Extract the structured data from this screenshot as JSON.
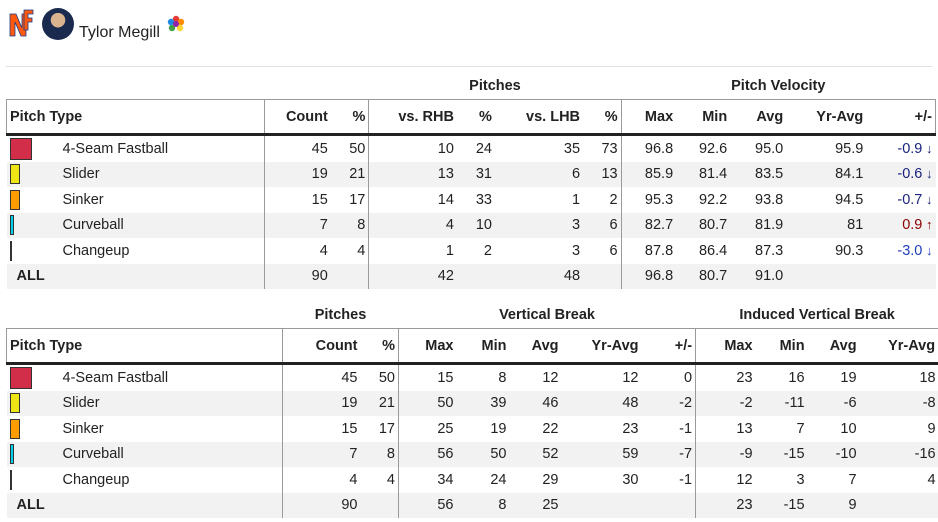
{
  "player": {
    "name": "Tylor Megill",
    "team_logo": "mets-ny-logo",
    "badge_icon": "rainbow-flower-icon"
  },
  "colors": {
    "fastball": "#d22d49",
    "slider": "#efe514",
    "sinker": "#fe9d00",
    "curveball": "#00d1ed",
    "changeup": "#1dbe3a"
  },
  "table1": {
    "group_headers": {
      "pitches": "Pitches",
      "velocity": "Pitch Velocity"
    },
    "columns": [
      "Pitch Type",
      "Count",
      "%",
      "vs. RHB",
      "%",
      "vs. LHB",
      "%",
      "Max",
      "Min",
      "Avg",
      "Yr-Avg",
      "+/-"
    ],
    "rows": [
      {
        "name": "4-Seam Fastball",
        "swatch_color": "#d22d49",
        "count": "45",
        "pct": "50",
        "rhb": "10",
        "rhb_pct": "24",
        "lhb": "35",
        "lhb_pct": "73",
        "max": "96.8",
        "min": "92.6",
        "avg": "95.0",
        "yr_avg": "95.9",
        "diff": "-0.9",
        "dir": "down"
      },
      {
        "name": "Slider",
        "swatch_color": "#efe514",
        "count": "19",
        "pct": "21",
        "rhb": "13",
        "rhb_pct": "31",
        "lhb": "6",
        "lhb_pct": "13",
        "max": "85.9",
        "min": "81.4",
        "avg": "83.5",
        "yr_avg": "84.1",
        "diff": "-0.6",
        "dir": "down"
      },
      {
        "name": "Sinker",
        "swatch_color": "#fe9d00",
        "count": "15",
        "pct": "17",
        "rhb": "14",
        "rhb_pct": "33",
        "lhb": "1",
        "lhb_pct": "2",
        "max": "95.3",
        "min": "92.2",
        "avg": "93.8",
        "yr_avg": "94.5",
        "diff": "-0.7",
        "dir": "down"
      },
      {
        "name": "Curveball",
        "swatch_color": "#00d1ed",
        "count": "7",
        "pct": "8",
        "rhb": "4",
        "rhb_pct": "10",
        "lhb": "3",
        "lhb_pct": "6",
        "max": "82.7",
        "min": "80.7",
        "avg": "81.9",
        "yr_avg": "81",
        "diff": "0.9",
        "dir": "up"
      },
      {
        "name": "Changeup",
        "swatch_color": "#1dbe3a",
        "count": "4",
        "pct": "4",
        "rhb": "1",
        "rhb_pct": "2",
        "lhb": "3",
        "lhb_pct": "6",
        "max": "87.8",
        "min": "86.4",
        "avg": "87.3",
        "yr_avg": "90.3",
        "diff": "-3.0",
        "dir": "down"
      }
    ],
    "all": {
      "label": "ALL",
      "count": "90",
      "rhb": "42",
      "lhb": "48",
      "max": "96.8",
      "min": "80.7",
      "avg": "91.0"
    }
  },
  "table2": {
    "group_headers": {
      "pitches": "Pitches",
      "vbreak": "Vertical Break",
      "ivb": "Induced Vertical Break"
    },
    "columns": [
      "Pitch Type",
      "Count",
      "%",
      "Max",
      "Min",
      "Avg",
      "Yr-Avg",
      "+/-",
      "Max",
      "Min",
      "Avg",
      "Yr-Avg"
    ],
    "rows": [
      {
        "name": "4-Seam Fastball",
        "swatch_color": "#d22d49",
        "count": "45",
        "pct": "50",
        "vb_max": "15",
        "vb_min": "8",
        "vb_avg": "12",
        "vb_yr": "12",
        "vb_diff": "0",
        "ivb_max": "23",
        "ivb_min": "16",
        "ivb_avg": "19",
        "ivb_yr": "18"
      },
      {
        "name": "Slider",
        "swatch_color": "#efe514",
        "count": "19",
        "pct": "21",
        "vb_max": "50",
        "vb_min": "39",
        "vb_avg": "46",
        "vb_yr": "48",
        "vb_diff": "-2",
        "ivb_max": "-2",
        "ivb_min": "-11",
        "ivb_avg": "-6",
        "ivb_yr": "-8"
      },
      {
        "name": "Sinker",
        "swatch_color": "#fe9d00",
        "count": "15",
        "pct": "17",
        "vb_max": "25",
        "vb_min": "19",
        "vb_avg": "22",
        "vb_yr": "23",
        "vb_diff": "-1",
        "ivb_max": "13",
        "ivb_min": "7",
        "ivb_avg": "10",
        "ivb_yr": "9"
      },
      {
        "name": "Curveball",
        "swatch_color": "#00d1ed",
        "count": "7",
        "pct": "8",
        "vb_max": "56",
        "vb_min": "50",
        "vb_avg": "52",
        "vb_yr": "59",
        "vb_diff": "-7",
        "ivb_max": "-9",
        "ivb_min": "-15",
        "ivb_avg": "-10",
        "ivb_yr": "-16"
      },
      {
        "name": "Changeup",
        "swatch_color": "#1dbe3a",
        "count": "4",
        "pct": "4",
        "vb_max": "34",
        "vb_min": "24",
        "vb_avg": "29",
        "vb_yr": "30",
        "vb_diff": "-1",
        "ivb_max": "12",
        "ivb_min": "3",
        "ivb_avg": "7",
        "ivb_yr": "4"
      }
    ],
    "all": {
      "label": "ALL",
      "count": "90",
      "vb_max": "56",
      "vb_min": "8",
      "vb_avg": "25",
      "ivb_max": "23",
      "ivb_min": "-15",
      "ivb_avg": "9"
    }
  }
}
